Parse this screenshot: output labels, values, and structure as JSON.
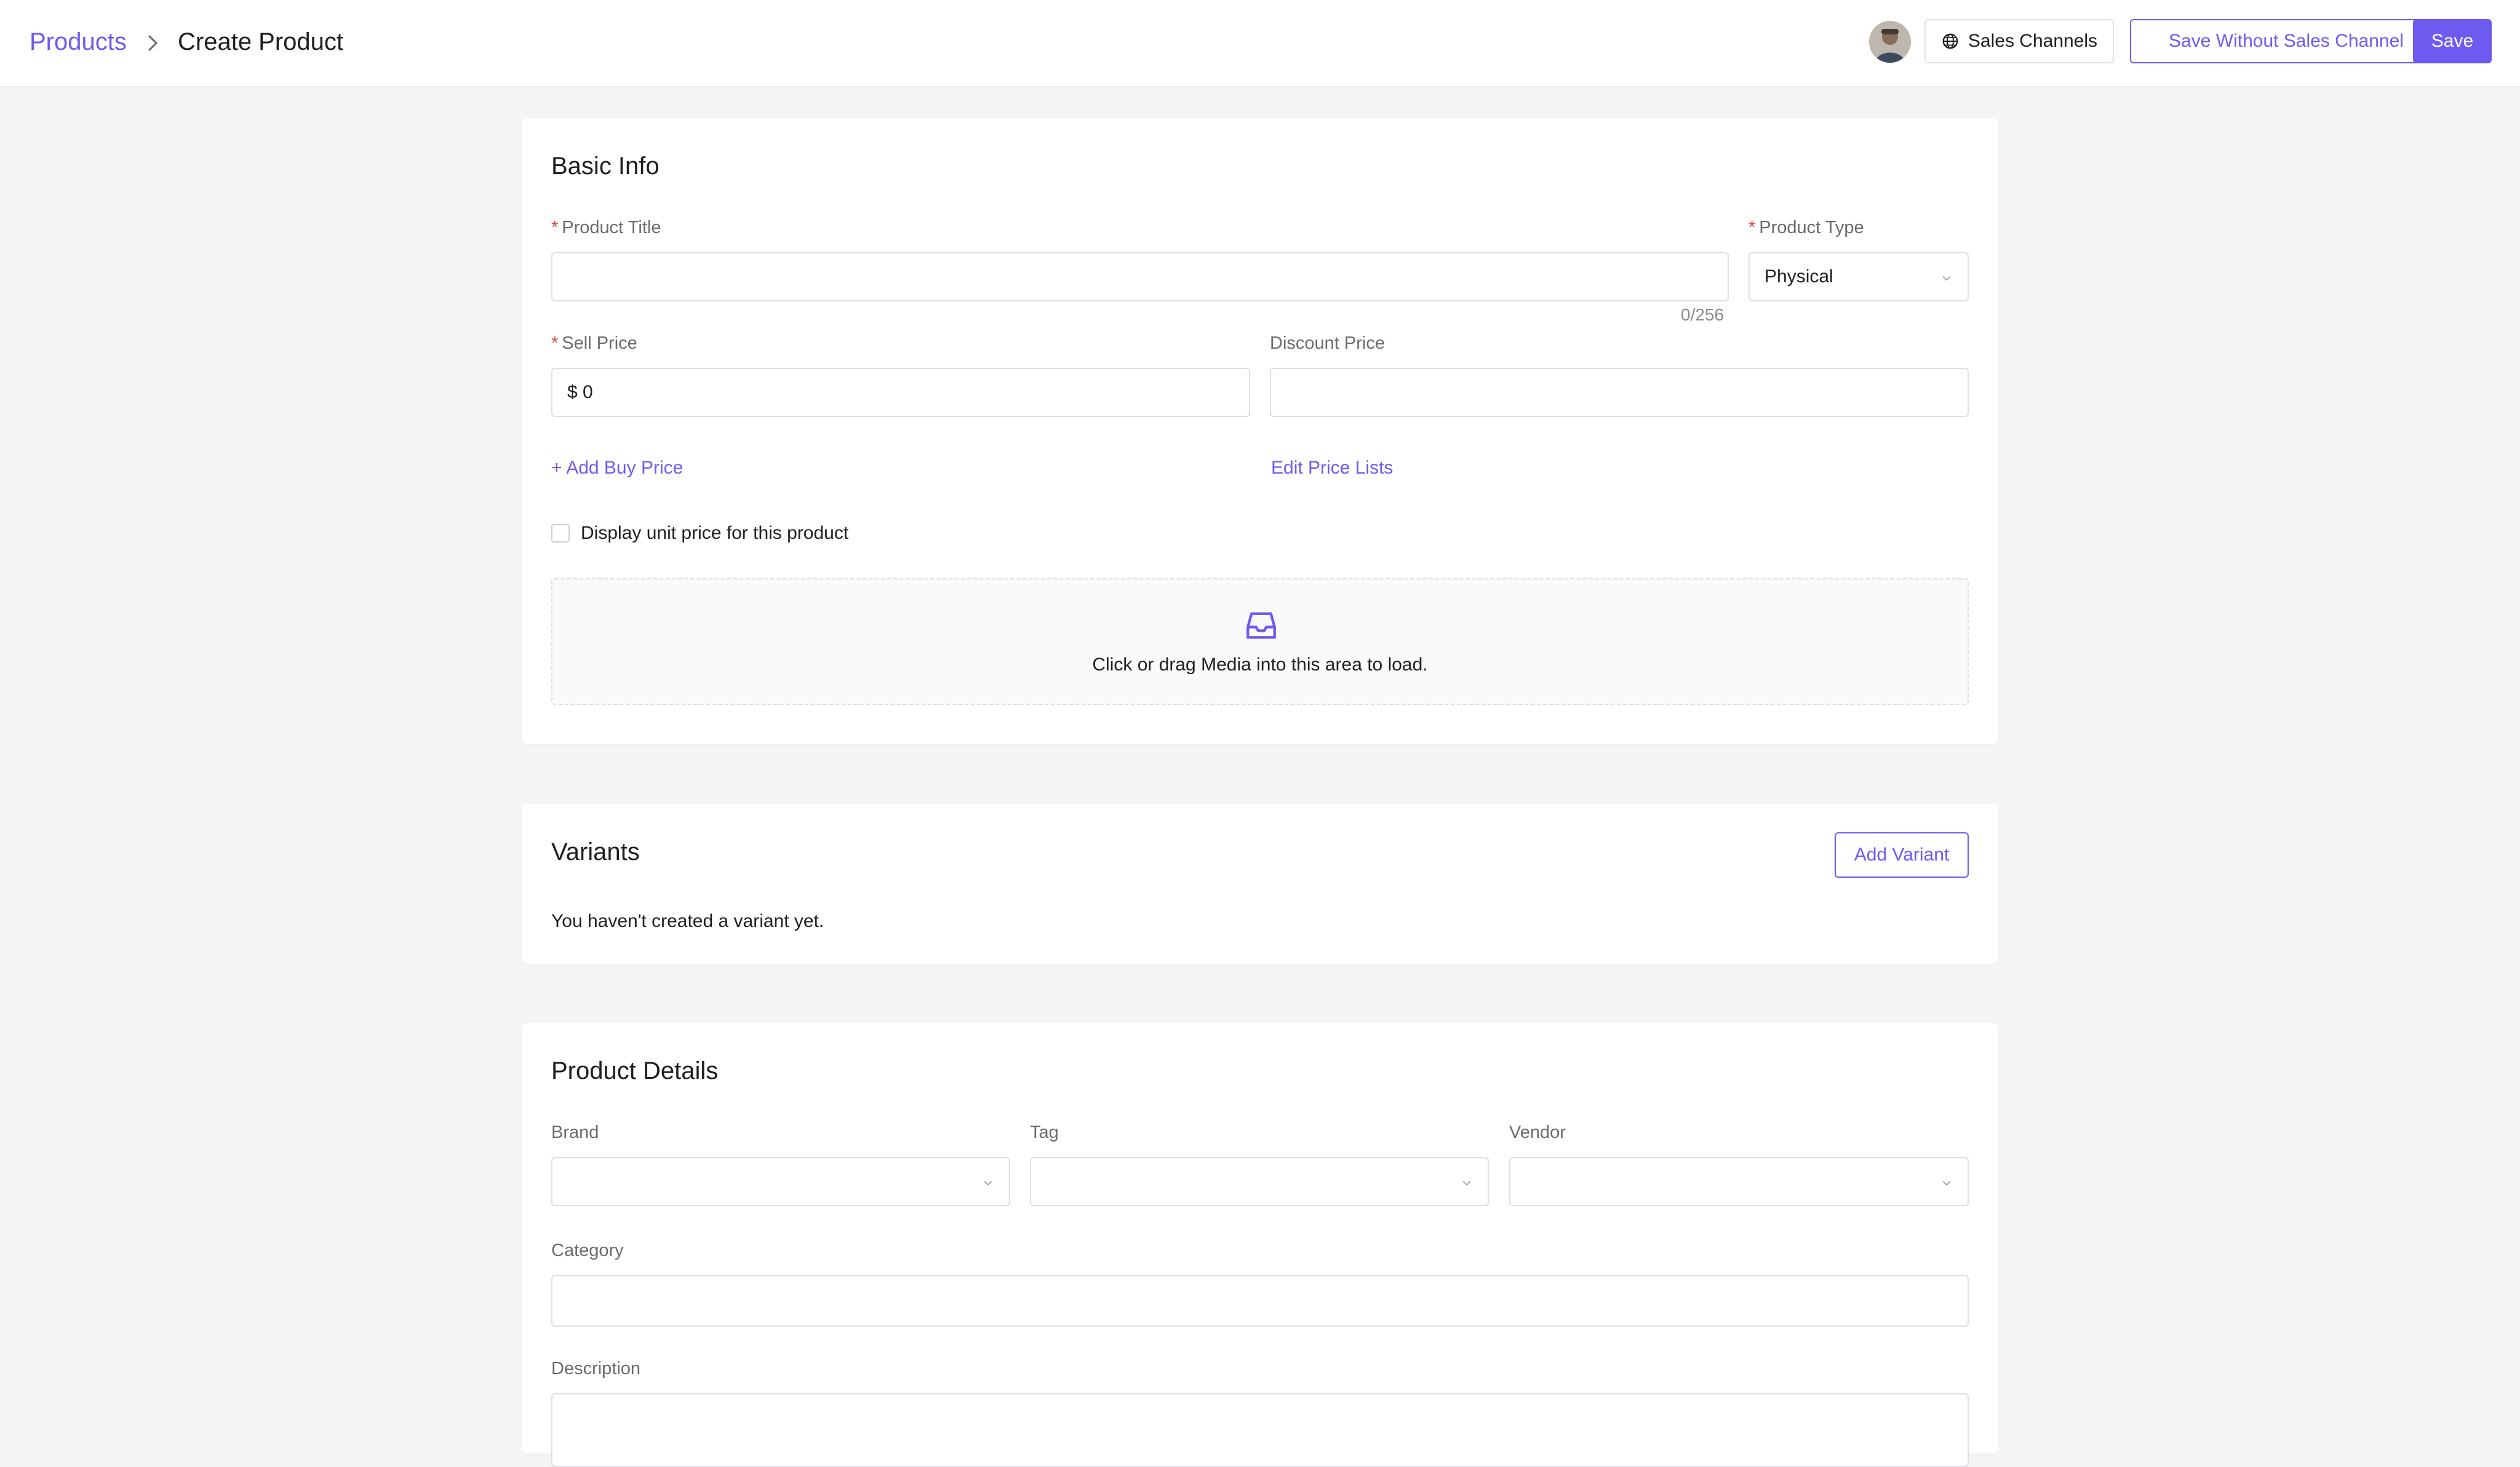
{
  "header": {
    "breadcrumb_root": "Products",
    "breadcrumb_current": "Create Product",
    "sales_channels_label": "Sales Channels",
    "save_without_label": "Save Without Sales Channel",
    "save_label": "Save"
  },
  "basic_info": {
    "title": "Basic Info",
    "product_title_label": "Product Title",
    "product_title_value": "",
    "product_title_counter": "0/256",
    "product_type_label": "Product Type",
    "product_type_value": "Physical",
    "sell_price_label": "Sell Price",
    "sell_price_value": "$ 0",
    "discount_price_label": "Discount Price",
    "discount_price_value": "",
    "add_buy_price_label": "+ Add Buy Price",
    "edit_price_lists_label": "Edit Price Lists",
    "unit_price_checkbox_label": "Display unit price for this product",
    "dropzone_text": "Click or drag Media into this area to load."
  },
  "variants": {
    "title": "Variants",
    "add_variant_label": "Add Variant",
    "empty_text": "You haven't created a variant yet."
  },
  "product_details": {
    "title": "Product Details",
    "brand_label": "Brand",
    "tag_label": "Tag",
    "vendor_label": "Vendor",
    "category_label": "Category",
    "description_label": "Description"
  },
  "colors": {
    "accent": "#6d5bf0",
    "required": "#e0453b",
    "background": "#f5f5f7"
  },
  "icons": {
    "breadcrumb_separator": "chevron-right-icon",
    "sales_channels": "globe-icon",
    "select": "chevron-down-icon",
    "dropzone": "inbox-icon"
  }
}
